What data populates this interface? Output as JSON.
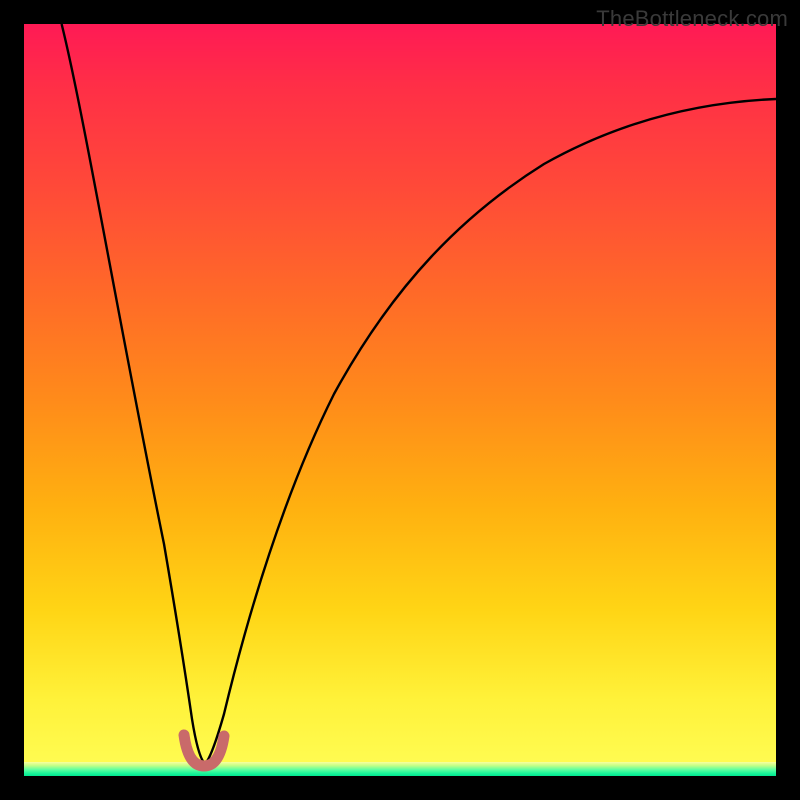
{
  "watermark": {
    "text": "TheBottleneck.com"
  },
  "chart_data": {
    "type": "line",
    "title": "",
    "xlabel": "",
    "ylabel": "",
    "xlim": [
      0,
      100
    ],
    "ylim": [
      0,
      100
    ],
    "grid": false,
    "series": [
      {
        "name": "bottleneck-curve",
        "x": [
          5,
          7,
          9,
          11,
          13,
          15,
          17,
          19,
          20.5,
          22,
          23,
          24,
          25,
          26,
          27,
          28,
          30,
          33,
          37,
          42,
          48,
          55,
          63,
          72,
          82,
          92,
          100
        ],
        "values": [
          100,
          90,
          80,
          70,
          60,
          50,
          40,
          28,
          17,
          8,
          3,
          1,
          1,
          3,
          8,
          14,
          24,
          35,
          46,
          55,
          63,
          70,
          76,
          81,
          85,
          88,
          90
        ]
      },
      {
        "name": "min-marker",
        "x": [
          22.5,
          23.5,
          24,
          24.5,
          25.5
        ],
        "values": [
          4,
          1.5,
          1,
          1.5,
          4
        ]
      }
    ],
    "colors": {
      "curve": "#000000",
      "marker": "#c96a6a",
      "gradient_top": "#ff1a55",
      "gradient_mid": "#ffb010",
      "gradient_bottom": "#fffd56",
      "band": "#00e890"
    }
  }
}
